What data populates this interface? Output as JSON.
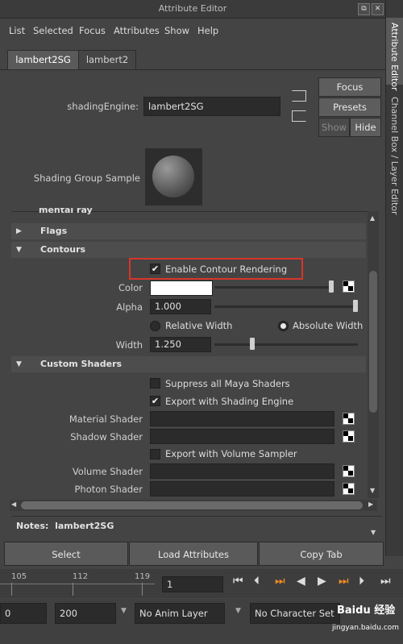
{
  "window": {
    "title": "Attribute Editor"
  },
  "menu": [
    "List",
    "Selected",
    "Focus",
    "Attributes",
    "Show",
    "Help"
  ],
  "tabs": [
    "lambert2SG",
    "lambert2"
  ],
  "shading_engine": {
    "label": "shadingEngine:",
    "value": "lambert2SG"
  },
  "side_buttons": {
    "focus": "Focus",
    "presets": "Presets",
    "show": "Show",
    "hide": "Hide"
  },
  "sample": {
    "label": "Shading Group Sample"
  },
  "right_tabs": {
    "attr": "Attribute Editor",
    "channel": "Channel Box / Layer Editor"
  },
  "sections": {
    "mental_ray": "mental ray",
    "flags": "Flags",
    "contours": "Contours",
    "custom_shaders": "Custom Shaders"
  },
  "contours": {
    "enable_label": "Enable Contour Rendering",
    "color_label": "Color",
    "alpha_label": "Alpha",
    "alpha_value": "1.000",
    "relative_width": "Relative Width",
    "absolute_width": "Absolute Width",
    "width_label": "Width",
    "width_value": "1.250"
  },
  "custom": {
    "suppress": "Suppress all Maya Shaders",
    "export_shading": "Export with Shading Engine",
    "material_shader": "Material Shader",
    "shadow_shader": "Shadow Shader",
    "export_volume": "Export with Volume Sampler",
    "volume_shader": "Volume Shader",
    "photon_shader": "Photon Shader"
  },
  "notes": "Notes:  lambert2SG",
  "bottom_buttons": {
    "select": "Select",
    "load": "Load Attributes",
    "copy": "Copy Tab"
  },
  "timeline": {
    "ticks": [
      "105",
      "112",
      "119"
    ],
    "current_frame": "1"
  },
  "range": {
    "start": "0",
    "end": "200",
    "anim_layer": "No Anim Layer",
    "character": "No Character Set"
  },
  "watermark": {
    "main": "Baidu 经验",
    "sub": "jingyan.baidu.com"
  }
}
